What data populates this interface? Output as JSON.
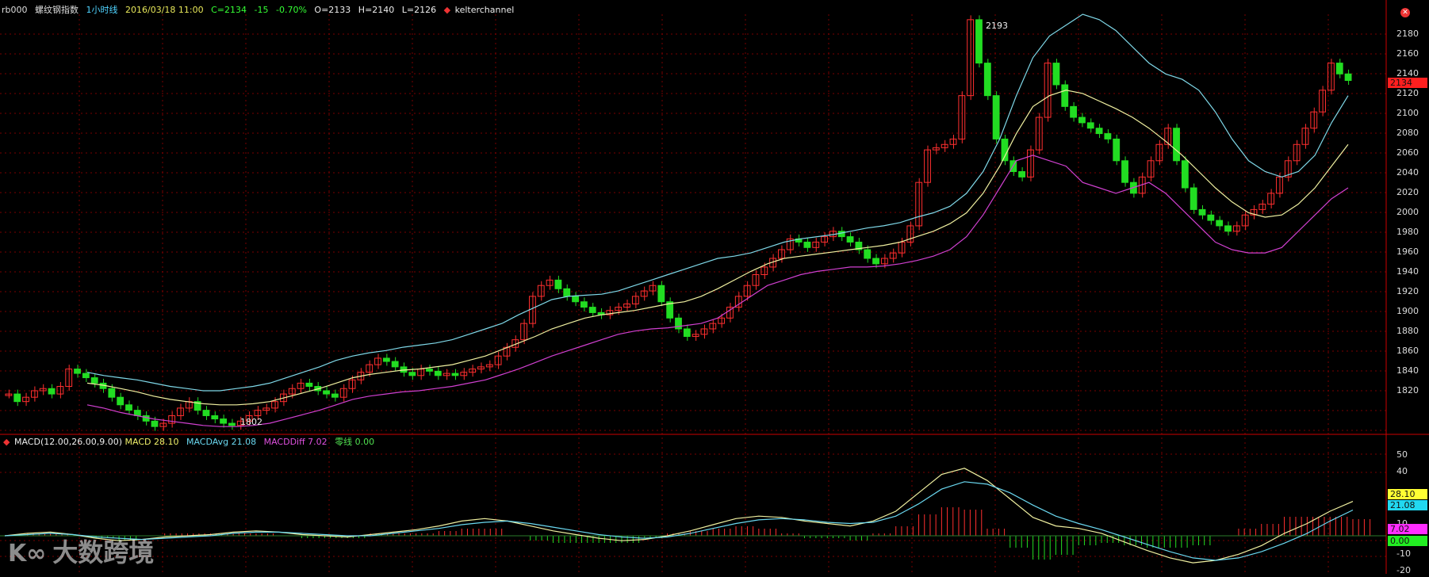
{
  "header": {
    "symbol": "rb000",
    "name": "螺纹钢指数",
    "period": "1小时线",
    "datetime": "2016/03/18 11:00",
    "close_text": "C=2134",
    "change_text": "-15",
    "pct_text": "-0.70%",
    "open_text": "O=2133",
    "high_text": "H=2140",
    "low_text": "L=2126",
    "indicator": "kelterchannel"
  },
  "macd_header": {
    "name": "MACD(12.00,26.00,9.00)",
    "macd": "MACD 28.10",
    "avg": "MACDAvg 21.08",
    "diff": "MACDDiff 7.02",
    "zero": "零线 0.00"
  },
  "price_axis": {
    "ticks": [
      "2180",
      "2160",
      "2140",
      "2120",
      "2100",
      "2080",
      "2060",
      "2040",
      "2020",
      "2000",
      "1980",
      "1960",
      "1940",
      "1920",
      "1900",
      "1880",
      "1860",
      "1840",
      "1820"
    ]
  },
  "macd_axis": {
    "ticks": [
      "50",
      "40",
      "10",
      "-10",
      "-20"
    ]
  },
  "labels": {
    "price_last": "2134",
    "macd_val": "28.10",
    "avg_val": "21.08",
    "diff_val": "7.02",
    "zero_val": "0.00",
    "hi_annot": "2193",
    "lo_annot": "1802"
  },
  "watermark": "大数跨境",
  "colors": {
    "up": "#ff2f2f",
    "down": "#22dd22",
    "upper": "#7fd8e8",
    "mid": "#f0f0a0",
    "lower": "#d040d0",
    "grid": "#7a0000"
  },
  "chart_data": {
    "type": "candlestick",
    "title": "rb000 螺纹钢指数 1小时线",
    "ylim": [
      1810,
      2195
    ],
    "annotations": [
      {
        "text": "2193",
        "value": 2193
      },
      {
        "text": "1802",
        "value": 1802
      }
    ],
    "closes": [
      1845,
      1838,
      1842,
      1848,
      1850,
      1845,
      1852,
      1868,
      1864,
      1860,
      1855,
      1850,
      1842,
      1835,
      1830,
      1825,
      1820,
      1815,
      1818,
      1825,
      1832,
      1838,
      1830,
      1825,
      1822,
      1818,
      1816,
      1820,
      1825,
      1830,
      1832,
      1838,
      1845,
      1850,
      1855,
      1852,
      1848,
      1845,
      1842,
      1850,
      1858,
      1865,
      1872,
      1878,
      1875,
      1870,
      1865,
      1862,
      1868,
      1866,
      1862,
      1864,
      1862,
      1865,
      1868,
      1870,
      1872,
      1880,
      1888,
      1895,
      1910,
      1935,
      1945,
      1950,
      1942,
      1935,
      1930,
      1925,
      1920,
      1918,
      1922,
      1925,
      1928,
      1935,
      1940,
      1945,
      1930,
      1915,
      1905,
      1898,
      1900,
      1905,
      1910,
      1915,
      1925,
      1935,
      1945,
      1955,
      1962,
      1970,
      1978,
      1988,
      1985,
      1980,
      1985,
      1990,
      1995,
      1990,
      1985,
      1978,
      1970,
      1965,
      1970,
      1975,
      1985,
      2000,
      2040,
      2070,
      2072,
      2075,
      2080,
      2120,
      2190,
      2150,
      2120,
      2080,
      2060,
      2050,
      2045,
      2070,
      2100,
      2150,
      2130,
      2110,
      2100,
      2095,
      2090,
      2085,
      2080,
      2060,
      2040,
      2030,
      2045,
      2060,
      2075,
      2090,
      2060,
      2035,
      2015,
      2010,
      2005,
      2000,
      1995,
      2000,
      2010,
      2015,
      2020,
      2030,
      2045,
      2060,
      2075,
      2090,
      2105,
      2125,
      2150,
      2140,
      2134
    ],
    "upper": [
      1865,
      1862,
      1860,
      1858,
      1855,
      1852,
      1850,
      1848,
      1848,
      1850,
      1852,
      1855,
      1860,
      1865,
      1870,
      1876,
      1880,
      1883,
      1885,
      1888,
      1890,
      1892,
      1895,
      1900,
      1905,
      1910,
      1918,
      1925,
      1932,
      1935,
      1936,
      1937,
      1940,
      1945,
      1950,
      1955,
      1960,
      1965,
      1970,
      1972,
      1975,
      1980,
      1985,
      1988,
      1990,
      1992,
      1995,
      1998,
      2000,
      2003,
      2008,
      2012,
      2018,
      2030,
      2050,
      2080,
      2120,
      2155,
      2175,
      2185,
      2195,
      2190,
      2180,
      2165,
      2150,
      2140,
      2135,
      2125,
      2105,
      2080,
      2060,
      2050,
      2045,
      2050,
      2065,
      2095,
      2120
    ],
    "mid": [
      1855,
      1853,
      1850,
      1847,
      1843,
      1840,
      1838,
      1836,
      1835,
      1835,
      1836,
      1838,
      1842,
      1846,
      1850,
      1855,
      1860,
      1863,
      1865,
      1867,
      1868,
      1870,
      1872,
      1876,
      1880,
      1886,
      1892,
      1898,
      1905,
      1910,
      1915,
      1918,
      1920,
      1922,
      1925,
      1928,
      1930,
      1935,
      1942,
      1950,
      1958,
      1965,
      1970,
      1972,
      1974,
      1976,
      1978,
      1980,
      1982,
      1985,
      1990,
      1995,
      2002,
      2012,
      2030,
      2055,
      2085,
      2110,
      2120,
      2125,
      2122,
      2115,
      2108,
      2100,
      2090,
      2078,
      2065,
      2050,
      2035,
      2022,
      2012,
      2008,
      2010,
      2020,
      2035,
      2055,
      2075
    ],
    "lower": [
      1835,
      1832,
      1828,
      1825,
      1822,
      1820,
      1818,
      1816,
      1815,
      1815,
      1816,
      1818,
      1822,
      1826,
      1830,
      1835,
      1840,
      1843,
      1845,
      1847,
      1848,
      1850,
      1852,
      1855,
      1858,
      1863,
      1868,
      1874,
      1880,
      1885,
      1890,
      1895,
      1900,
      1903,
      1905,
      1906,
      1908,
      1910,
      1915,
      1925,
      1935,
      1945,
      1950,
      1955,
      1958,
      1960,
      1962,
      1962,
      1963,
      1965,
      1968,
      1972,
      1978,
      1990,
      2010,
      2035,
      2060,
      2065,
      2060,
      2055,
      2040,
      2035,
      2030,
      2035,
      2040,
      2030,
      2015,
      2000,
      1985,
      1978,
      1975,
      1975,
      1980,
      1995,
      2010,
      2025,
      2035
    ],
    "macd": [
      0,
      2,
      3,
      1,
      -2,
      -4,
      -3,
      -1,
      0,
      1,
      3,
      4,
      3,
      1,
      0,
      -1,
      1,
      3,
      5,
      8,
      12,
      14,
      12,
      8,
      4,
      1,
      -2,
      -4,
      -3,
      0,
      4,
      9,
      14,
      16,
      15,
      12,
      10,
      8,
      12,
      20,
      35,
      50,
      55,
      45,
      30,
      15,
      8,
      6,
      2,
      -5,
      -12,
      -18,
      -22,
      -20,
      -15,
      -8,
      2,
      10,
      20,
      28
    ],
    "signal": [
      0,
      1,
      2,
      1,
      -1,
      -2,
      -3,
      -2,
      -1,
      0,
      2,
      3,
      3,
      2,
      1,
      0,
      0,
      2,
      4,
      6,
      9,
      11,
      12,
      10,
      7,
      4,
      1,
      -1,
      -2,
      -1,
      2,
      6,
      10,
      13,
      14,
      13,
      11,
      10,
      11,
      16,
      26,
      38,
      44,
      42,
      35,
      25,
      16,
      10,
      5,
      -1,
      -7,
      -13,
      -18,
      -20,
      -18,
      -13,
      -6,
      2,
      12,
      21
    ],
    "macd_histogram_range": [
      -20,
      20
    ]
  }
}
